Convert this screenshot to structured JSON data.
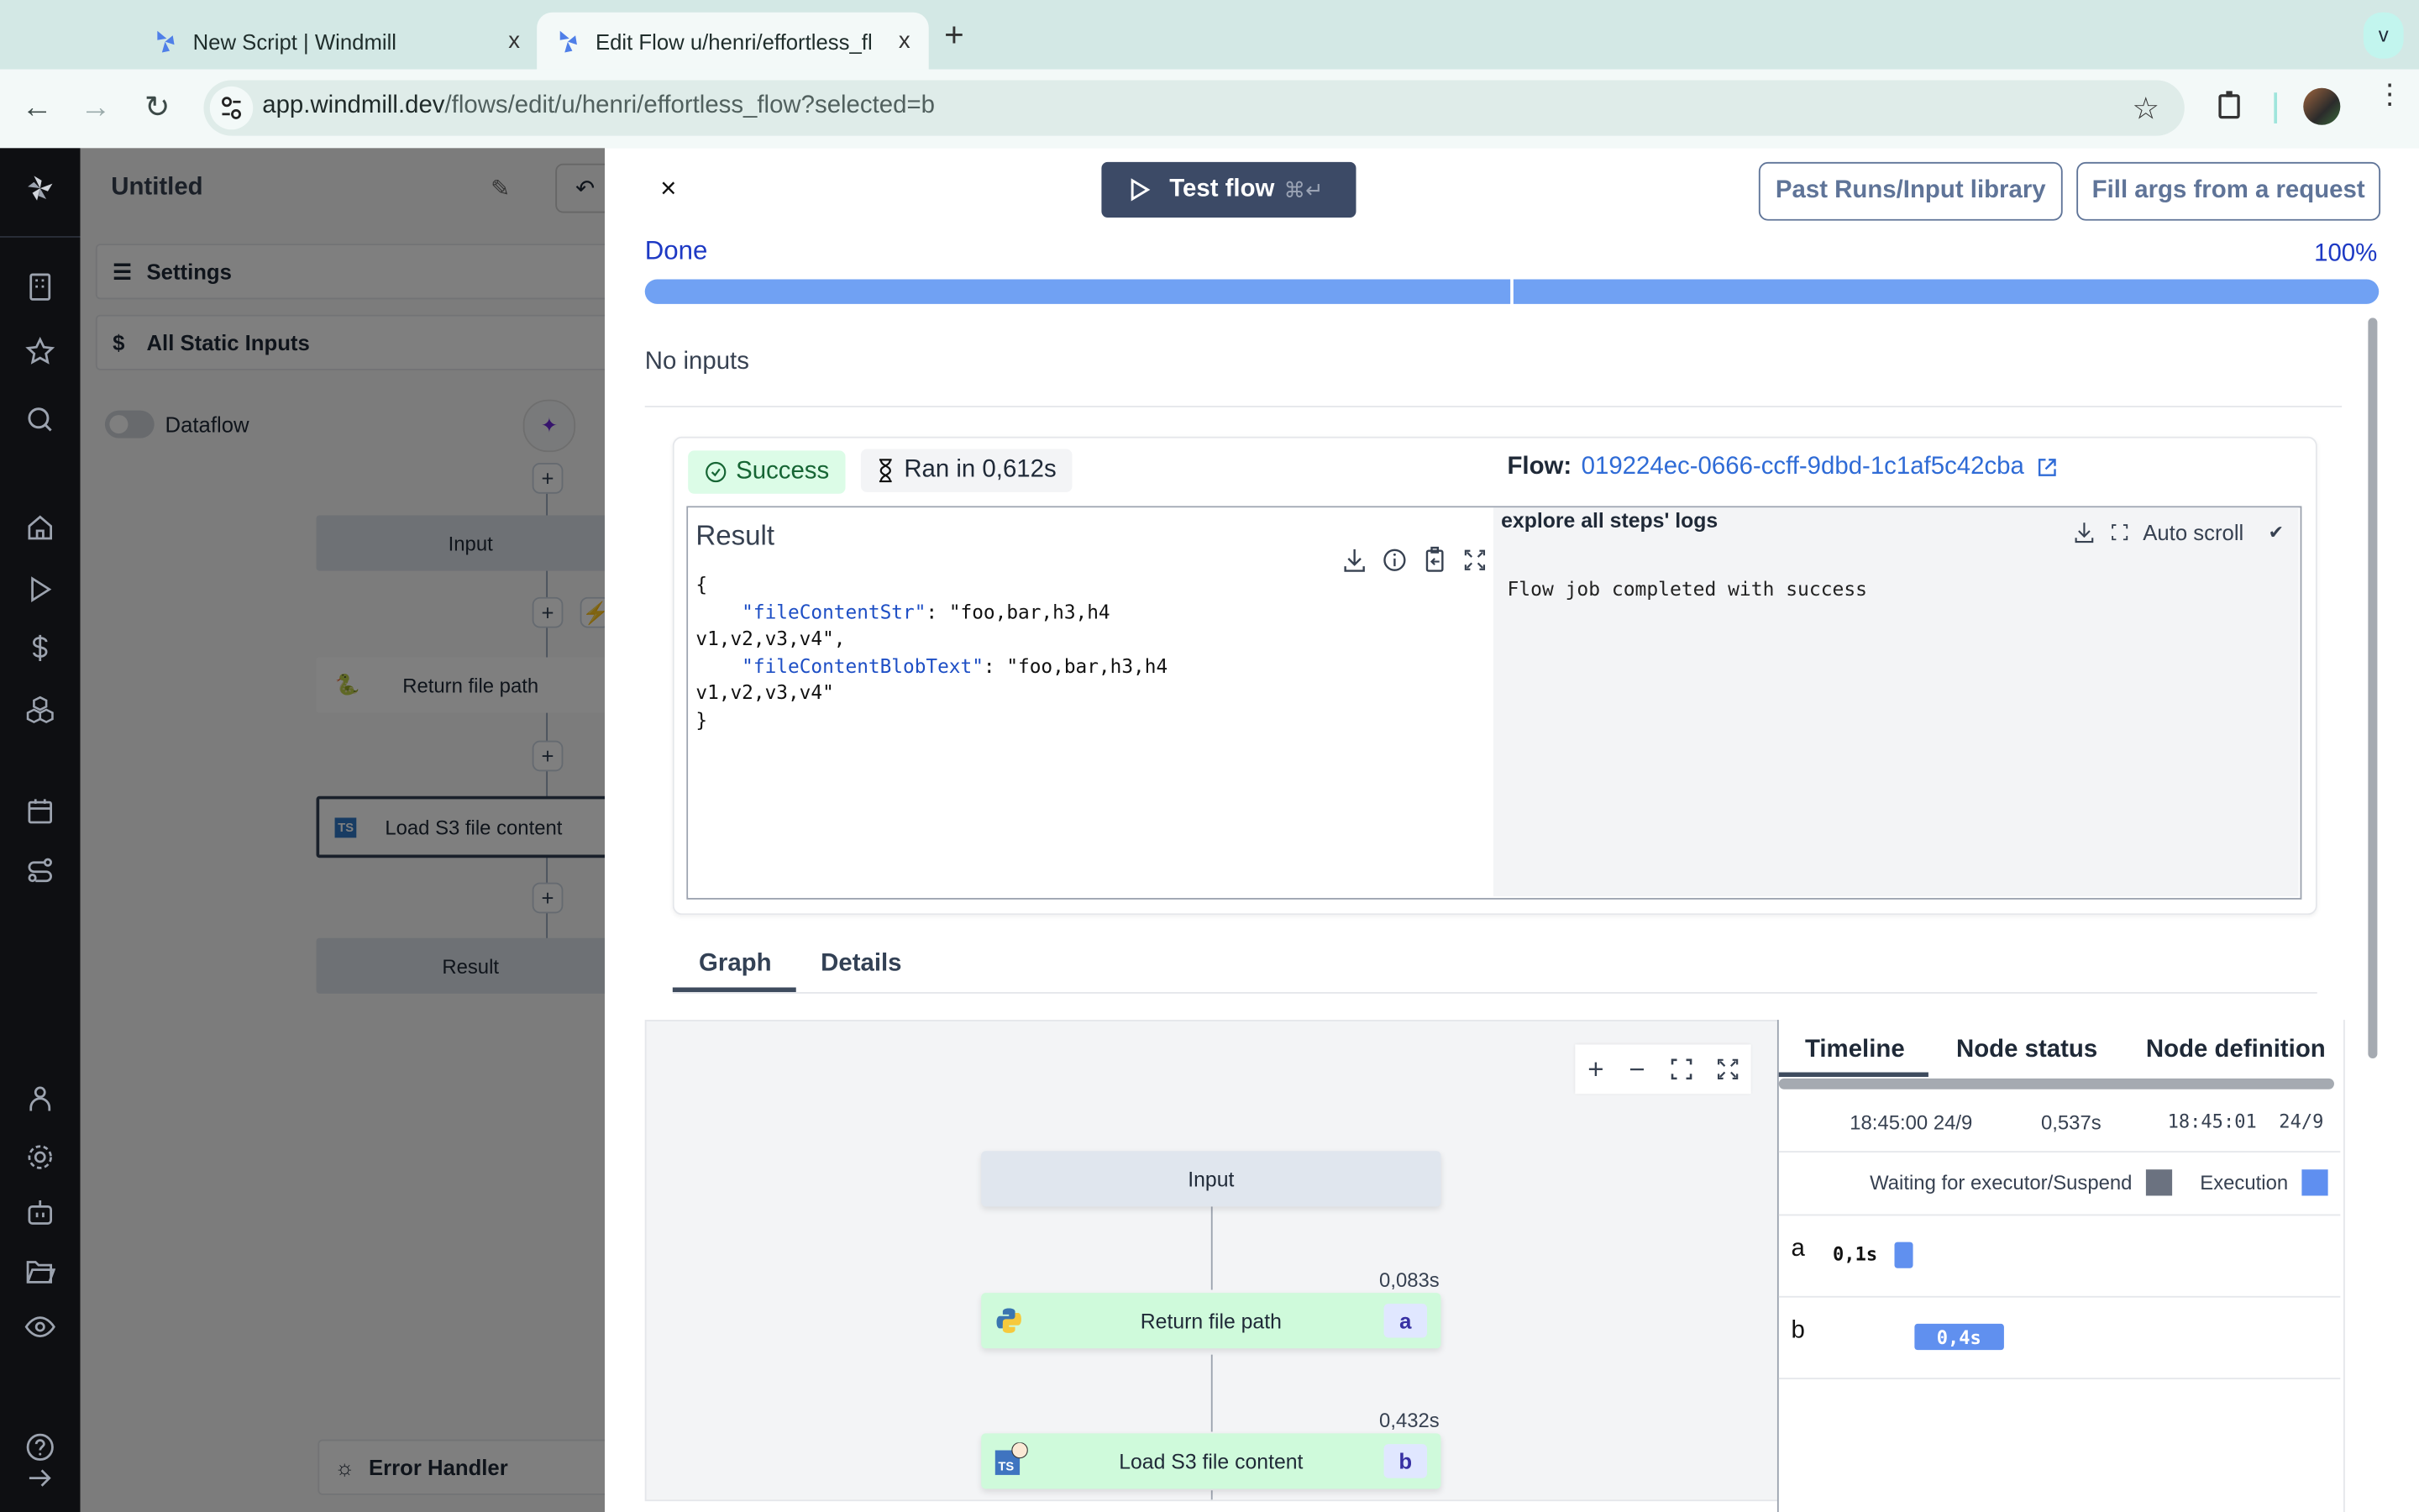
{
  "browser": {
    "tabs": [
      {
        "title": "New Script | Windmill",
        "active": false
      },
      {
        "title": "Edit Flow u/henri/effortless_fl",
        "active": true
      }
    ],
    "new_tab": "+",
    "close": "x",
    "menu": "v",
    "url_host": "app.windmill.dev",
    "url_path": "/flows/edit/u/henri/effortless_flow?selected=b"
  },
  "editor": {
    "title": "Untitled",
    "settings": "Settings",
    "static_inputs": "All Static Inputs",
    "dataflow": "Dataflow",
    "dataflow_on": false,
    "nodes": [
      "Input",
      "Return file path",
      "Load S3 file content",
      "Result"
    ],
    "error_handler": "Error Handler"
  },
  "drawer": {
    "close": "×",
    "test_flow": "Test flow",
    "test_shortcut": "⌘↵",
    "past_runs": "Past Runs/Input library",
    "fill_args": "Fill args from a request",
    "status": "Done",
    "progress_percent": "100%",
    "progress_value": 1.0,
    "progress_steps": 2,
    "no_inputs": "No inputs",
    "result_status": "Success",
    "ran_in": "Ran in 0,612s",
    "flow_label": "Flow:",
    "flow_id": "019224ec-0666-ccff-9dbd-1c1af5c42cba",
    "result_label": "Result",
    "result_json": {
      "open": "{",
      "lines": [
        {
          "key": "\"fileContentStr\"",
          "value": ": \"foo,bar,h3,h4\nv1,v2,v3,v4\","
        },
        {
          "key": "\"fileContentBlobText\"",
          "value": ": \"foo,bar,h3,h4\nv1,v2,v3,v4\""
        }
      ],
      "close": "}"
    },
    "logs_header": "explore all steps' logs",
    "auto_scroll": "Auto scroll",
    "auto_scroll_checked": "✔",
    "log_text": "Flow job completed with success",
    "tabs": [
      "Graph",
      "Details"
    ],
    "active_tab": "Graph"
  },
  "graph": {
    "zoom_controls": [
      "+",
      "−",
      "fit",
      "fullscreen"
    ],
    "nodes": [
      {
        "label": "Input",
        "kind": "input"
      },
      {
        "label": "Return file path",
        "id": "a",
        "lang": "python",
        "duration": "0,083s"
      },
      {
        "label": "Load S3 file content",
        "id": "b",
        "lang": "typescript-bun",
        "duration": "0,432s"
      }
    ]
  },
  "timeline": {
    "tabs": [
      "Timeline",
      "Node status",
      "Node definition"
    ],
    "active_tab": "Timeline",
    "start": "18:45:00 24/9",
    "total": "0,537s",
    "end": "18:45:01  24/9",
    "legend": [
      {
        "label": "Waiting for executor/Suspend",
        "color": "#6b7280"
      },
      {
        "label": "Execution",
        "color": "#5f8ff0"
      }
    ],
    "rows": [
      {
        "id": "a",
        "duration": "0,1s",
        "start_s": 0.0,
        "exec_s": 0.083
      },
      {
        "id": "b",
        "duration": "0,4s",
        "start_s": 0.105,
        "exec_s": 0.432
      }
    ],
    "total_s": 0.537
  },
  "colors": {
    "accent": "#1d39c4",
    "progress": "#70a1f3",
    "button_dark": "#3c4a66",
    "success_bg": "#dcfce7",
    "node_success": "#cffadb"
  }
}
